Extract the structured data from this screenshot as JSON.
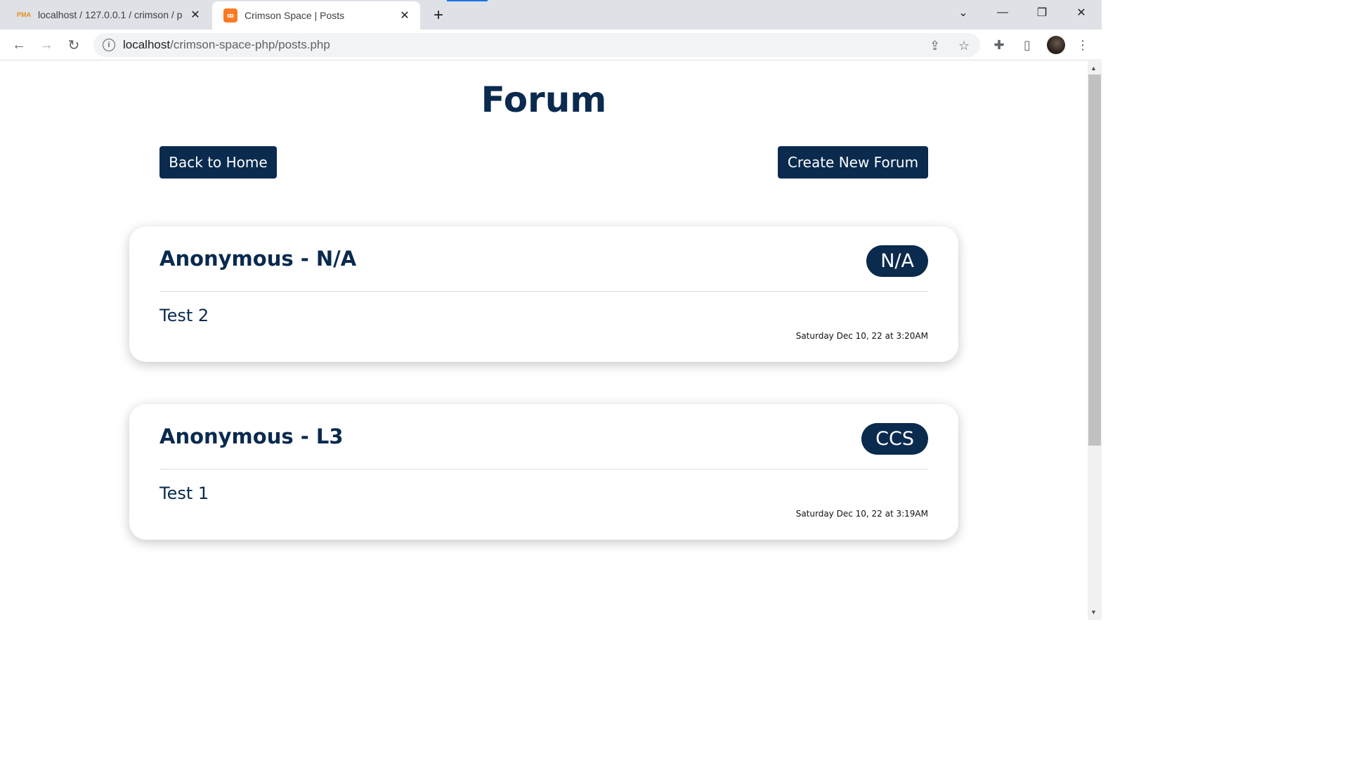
{
  "browser": {
    "tabs": [
      {
        "icon": "phpmyadmin-icon",
        "title": "localhost / 127.0.0.1 / crimson / p",
        "favicon_text": "PMA"
      },
      {
        "icon": "xampp-icon",
        "title": "Crimson Space | Posts",
        "favicon_text": "ꝏ"
      }
    ],
    "new_tab": "+",
    "url_host": "localhost",
    "url_path": "/crimson-space-php/posts.php"
  },
  "page": {
    "title": "Forum",
    "back_button": "Back to Home",
    "create_button": "Create New Forum"
  },
  "posts": [
    {
      "author": "Anonymous - N/A",
      "tag": "N/A",
      "content": "Test 2",
      "date": "Saturday Dec 10, 22 at 3:20AM"
    },
    {
      "author": "Anonymous - L3",
      "tag": "CCS",
      "content": "Test 1",
      "date": "Saturday Dec 10, 22 at 3:19AM"
    }
  ],
  "colors": {
    "primary": "#0a2a4e",
    "tab_accent": "#1a73e8"
  }
}
